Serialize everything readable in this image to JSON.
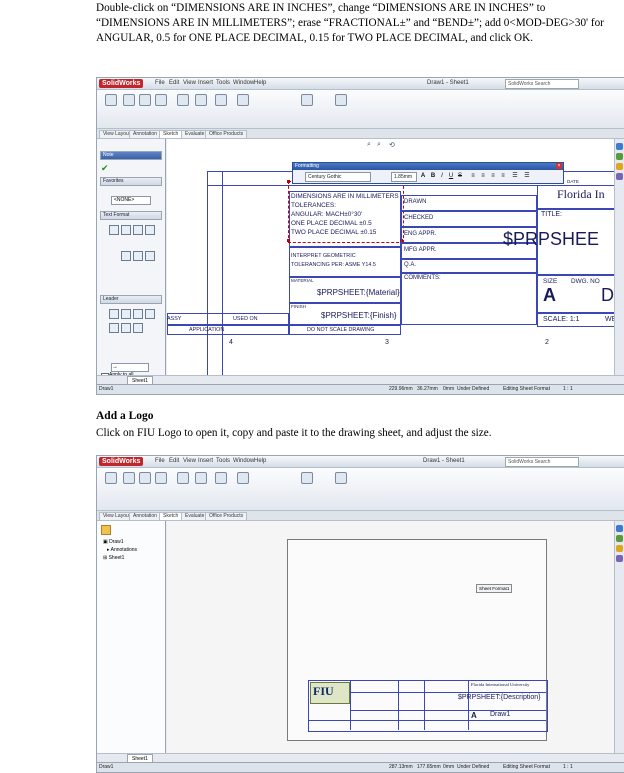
{
  "instructions": {
    "para1": "Double-click on “DIMENSIONS ARE IN INCHES”, change “DIMENSIONS ARE IN INCHES” to “DIMENSIONS ARE IN MILLIMETERS”; erase “FRACTIONAL±” and “BEND±”; add 0<MOD-DEG>30' for ANGULAR, 0.5 for ONE PLACE DECIMAL, 0.15 for TWO PLACE DECIMAL, and click OK.",
    "heading2": "Add a Logo",
    "para2": "Click on FIU Logo to open it, copy and paste it to the drawing sheet, and adjust the size."
  },
  "app": {
    "logo": "SolidWorks",
    "menus": [
      "File",
      "Edit",
      "View",
      "Insert",
      "Tools",
      "Window",
      "Help"
    ],
    "search_placeholder": "SolidWorks Search",
    "ribbon_tabs": [
      "View Layout",
      "Annotation",
      "Sketch",
      "Evaluate",
      "Office Products"
    ]
  },
  "screenshot1": {
    "window_title": "Draw1 - Sheet1",
    "pm_title": "Note",
    "pm_sections": [
      "Favorites",
      "Text Format",
      "Leader"
    ],
    "favorite_value": "<NONE>",
    "apply_all": "Apply to all",
    "formatting": {
      "title": "Formatting",
      "font": "Century Gothic",
      "size": "1.85mm"
    },
    "title_block": {
      "note_lines": [
        "DIMENSIONS ARE IN MILLIMETERS",
        "TOLERANCES:",
        "ANGULAR: MACH±0°30'",
        "ONE PLACE DECIMAL    ±0.5",
        "TWO PLACE DECIMAL   ±0.15"
      ],
      "interpret": "INTERPRET GEOMETRIC",
      "tolerancing": "TOLERANCING PER: ASME Y14.5",
      "material_label": "MATERIAL",
      "material_value": "$PRPSHEET:{Material}",
      "finish_label": "FINISH",
      "finish_value": "$PRPSHEET:{Finish}",
      "application": "APPLICATION",
      "do_not_scale": "DO NOT SCALE DRAWING",
      "assy": "ASSY",
      "used_on": "USED ON",
      "name": "NAME",
      "date": "DATE",
      "drawn": "DRAWN",
      "checked": "CHECKED",
      "eng_appr": "ENG APPR.",
      "mfg_appr": "MFG APPR.",
      "qa": "Q.A.",
      "comments": "COMMENTS:",
      "company": "Florida In",
      "title_label": "TITLE:",
      "prpsheet": "$PRPSHEE",
      "size_label": "SIZE",
      "size_value": "A",
      "dwg_label": "DWG. NO",
      "dwg_value": "D",
      "scale": "SCALE: 1:1",
      "weight": "WE",
      "zone_numbers": [
        "4",
        "3",
        "2"
      ]
    },
    "sheet_tab": "Sheet1",
    "status": {
      "left": "Draw1",
      "x": "229.96mm",
      "y": "36.27mm",
      "z": "0mm",
      "state": "Under Defined",
      "mode": "Editing Sheet Format",
      "scale": "1 : 1"
    }
  },
  "screenshot2": {
    "window_title": "Draw1 - Sheet1",
    "tree": [
      "Draw1",
      "Annotations",
      "Sheet1"
    ],
    "sheet_format_tag": "Sheet Format1",
    "logo_text": "FIU",
    "company": "Florida International University",
    "prpsheet": "$PRPSHEET:{Description}",
    "size_value": "A",
    "drawing_name": "Draw1",
    "sheet_tab": "Sheet1",
    "status": {
      "left": "Draw1",
      "x": "287.13mm",
      "y": "177.65mm",
      "z": "0mm",
      "state": "Under Defined",
      "mode": "Editing Sheet Format",
      "scale": "1 : 1"
    }
  }
}
